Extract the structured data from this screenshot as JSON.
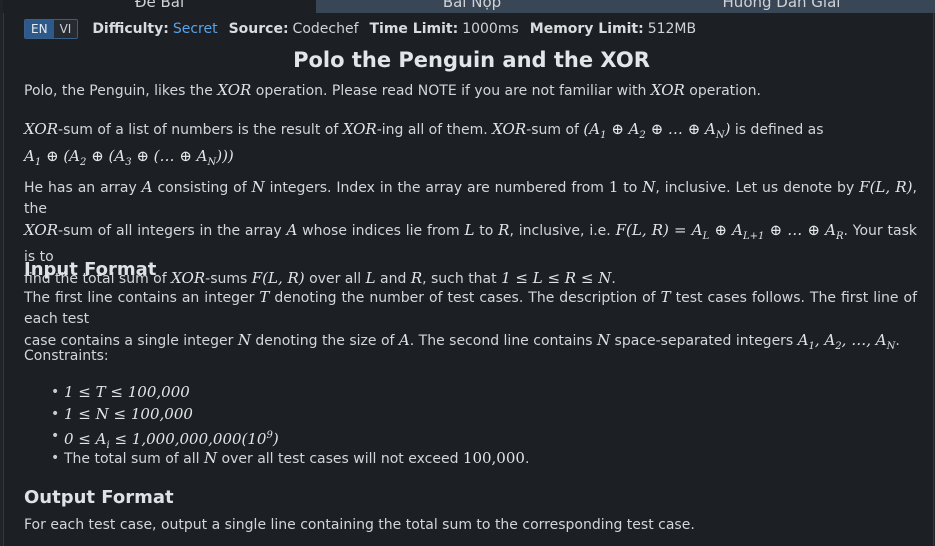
{
  "tabs": {
    "statement": "Đề Bài",
    "submissions": "Bài Nộp",
    "editorial": "Hướng Dẫn Giải"
  },
  "lang": {
    "en": "EN",
    "vi": "VI"
  },
  "meta": {
    "difficulty_label": "Difficulty:",
    "difficulty_value": "Secret",
    "source_label": "Source:",
    "source_value": "Codechef",
    "time_label": "Time Limit:",
    "time_value": "1000ms",
    "memory_label": "Memory Limit:",
    "memory_value": "512MB"
  },
  "title": "Polo the Penguin and the XOR",
  "intro": {
    "t1": "Polo, the Penguin, likes the ",
    "xor1": "XOR",
    "t2": " operation. Please read NOTE if you are not familiar with ",
    "xor2": "XOR",
    "t3": " operation."
  },
  "def": {
    "t1": "-sum of a list of numbers is the result of ",
    "t2": "-ing all of them. ",
    "t3": "-sum of ",
    "t4": " is defined as",
    "xor": "XOR"
  },
  "array_par": {
    "t1": "He has an array ",
    "t2": " consisting of ",
    "t3": " integers. Index in the array are numbered from ",
    "t4": " to ",
    "t5": ", inclusive. Let us denote by ",
    "t6": ", the",
    "t7": "-sum of all integers in the array ",
    "t8": " whose indices lie from ",
    "t9": " to ",
    "t10": ", inclusive, i.e. ",
    "t11": ". Your task is to",
    "t12": "find the total sum of ",
    "t13": "-sums ",
    "t14": " over all ",
    "t15": " and ",
    "t16": ", such that ",
    "t17": "."
  },
  "input_heading": "Input Format",
  "input_par": {
    "t1": "The first line contains an integer ",
    "t2": " denoting the number of test cases. The description of ",
    "t3": " test cases follows. The first line of each test",
    "t4": "case contains a single integer ",
    "t5": " denoting the size of ",
    "t6": ". The second line contains ",
    "t7": " space-separated integers ",
    "t8": "."
  },
  "constraints_label": "Constraints:",
  "constraints": {
    "c4_text1": "The total sum of all ",
    "c4_text2": " over all test cases will not exceed ",
    "c4_value": "100,000",
    "c4_end": "."
  },
  "output_heading": "Output Format",
  "output_par": "For each test case, output a single line containing the total sum to the corresponding test case."
}
